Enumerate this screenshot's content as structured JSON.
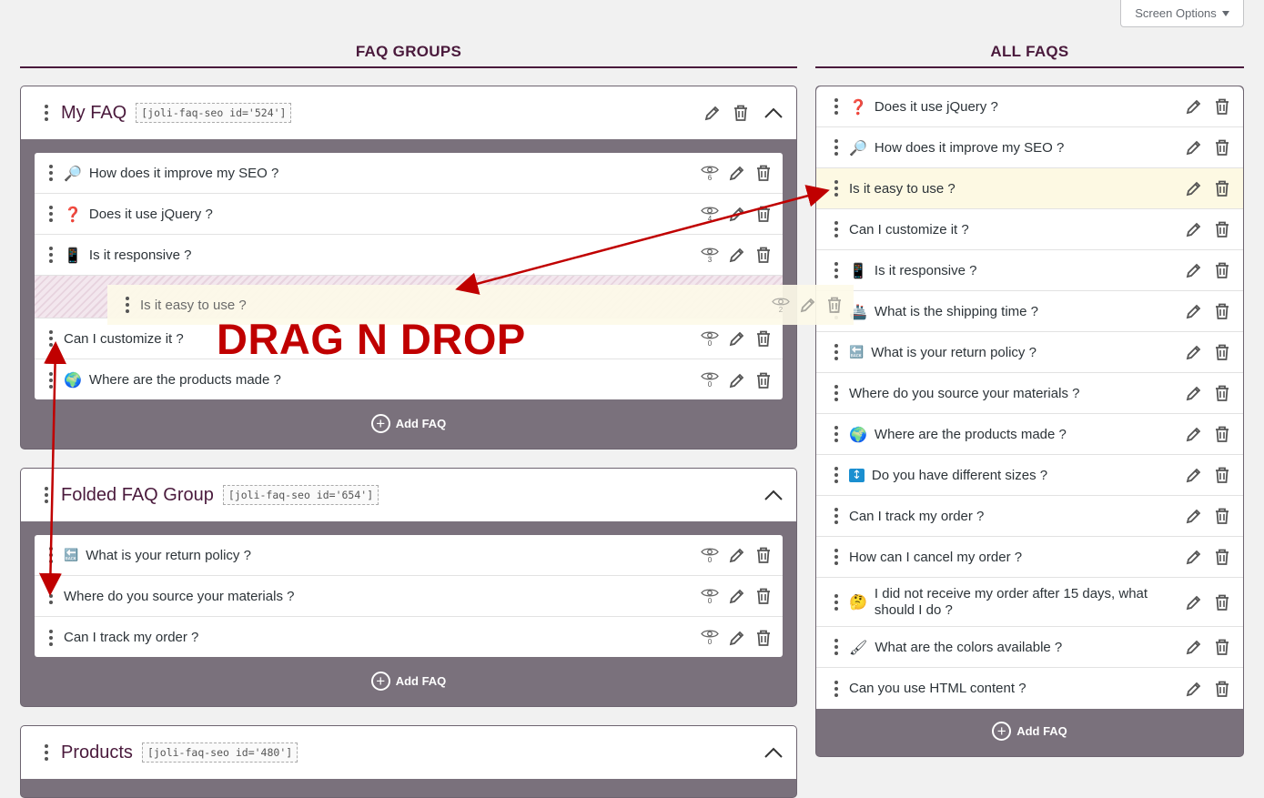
{
  "screen_options": {
    "label": "Screen Options"
  },
  "columns": {
    "groups_title": "FAQ GROUPS",
    "all_title": "ALL FAQS"
  },
  "groups": [
    {
      "title": "My FAQ",
      "shortcode": "[joli-faq-seo id='524']",
      "faqs": [
        {
          "icon": "🔎",
          "question": "How does it improve my SEO ?",
          "views": "6"
        },
        {
          "icon": "❓",
          "question": "Does it use jQuery ?",
          "views": "4"
        },
        {
          "icon": "📱",
          "question": "Is it responsive ?",
          "views": "3"
        },
        {
          "icon": "",
          "question": "Can I customize it ?",
          "views": "0"
        },
        {
          "icon": "🌍",
          "question": "Where are the products made ?",
          "views": "0"
        }
      ],
      "add_label": "Add FAQ"
    },
    {
      "title": "Folded FAQ Group",
      "shortcode": "[joli-faq-seo id='654']",
      "faqs": [
        {
          "icon": "🔙",
          "question": "What is your return policy ?",
          "views": "0"
        },
        {
          "icon": "",
          "question": "Where do you source your materials ?",
          "views": "0"
        },
        {
          "icon": "",
          "question": "Can I track my order ?",
          "views": "0"
        }
      ],
      "add_label": "Add FAQ"
    },
    {
      "title": "Products",
      "shortcode": "[joli-faq-seo id='480']"
    }
  ],
  "dragging_item": {
    "question": "Is it easy to use ?",
    "views": "2"
  },
  "overlay_text": "DRAG N DROP",
  "all_faqs": {
    "items": [
      {
        "icon": "❓",
        "question": "Does it use jQuery ?"
      },
      {
        "icon": "🔎",
        "question": "How does it improve my SEO ?"
      },
      {
        "icon": "",
        "question": "Is it easy to use ?"
      },
      {
        "icon": "",
        "question": "Can I customize it ?"
      },
      {
        "icon": "📱",
        "question": "Is it responsive ?"
      },
      {
        "icon": "🚢",
        "question": "What is the shipping time ?"
      },
      {
        "icon": "🔙",
        "question": "What is your return policy ?"
      },
      {
        "icon": "",
        "question": "Where do you source your materials ?"
      },
      {
        "icon": "🌍",
        "question": "Where are the products made ?"
      },
      {
        "icon": "↕",
        "question": "Do you have different sizes ?"
      },
      {
        "icon": "",
        "question": "Can I track my order ?"
      },
      {
        "icon": "",
        "question": "How can I cancel my order ?"
      },
      {
        "icon": "🤔",
        "question": "I did not receive my order after 15 days, what should I do ?"
      },
      {
        "icon": "🖌",
        "question": "What are the colors available ?"
      },
      {
        "icon": "",
        "question": "Can you use HTML content ?"
      }
    ],
    "add_label": "Add FAQ"
  },
  "colors": {
    "accent": "#4a1a3c",
    "group_bg": "#7a717c",
    "highlight": "#fdf9e3",
    "annotation": "#c00000"
  }
}
